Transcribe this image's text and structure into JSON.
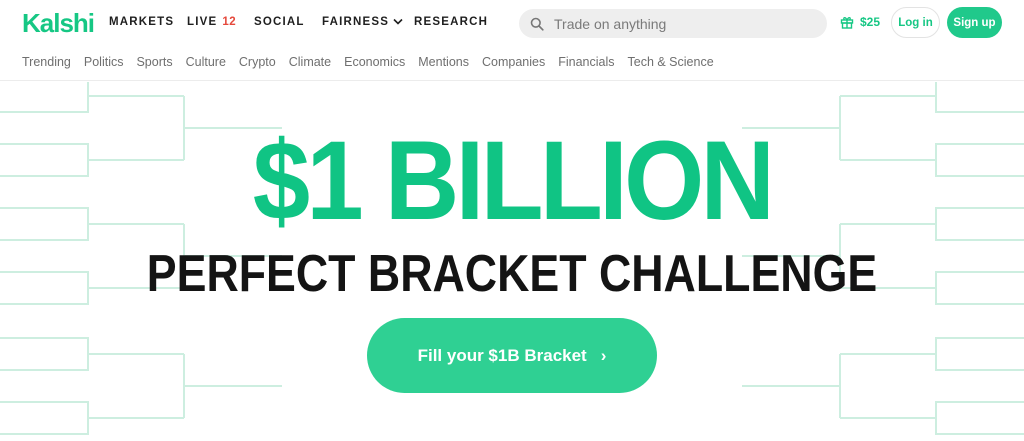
{
  "brand": {
    "logo_text": "Kalshi"
  },
  "nav": {
    "markets": "MARKETS",
    "live": "LIVE",
    "live_count": "12",
    "social": "SOCIAL",
    "fairness": "FAIRNESS",
    "research": "RESEARCH"
  },
  "search": {
    "placeholder": "Trade on anything"
  },
  "account": {
    "balance": "$25",
    "login": "Log in",
    "signup": "Sign up"
  },
  "categories": [
    "Trending",
    "Politics",
    "Sports",
    "Culture",
    "Crypto",
    "Climate",
    "Economics",
    "Mentions",
    "Companies",
    "Financials",
    "Tech & Science"
  ],
  "hero": {
    "headline": "$1 BILLION",
    "subheadline": "PERFECT BRACKET CHALLENGE",
    "cta": "Fill your $1B Bracket",
    "cta_arrow": "›"
  },
  "colors": {
    "brand_green": "#16c784",
    "cta_green": "#2fd093",
    "live_red": "#e5483b",
    "bracket_line": "#cdeee0"
  },
  "icons": {
    "search": "search-icon",
    "gift": "gift-icon",
    "fairness_dropdown": "chevron-down-icon",
    "cta_arrow": "chevron-right-icon"
  }
}
